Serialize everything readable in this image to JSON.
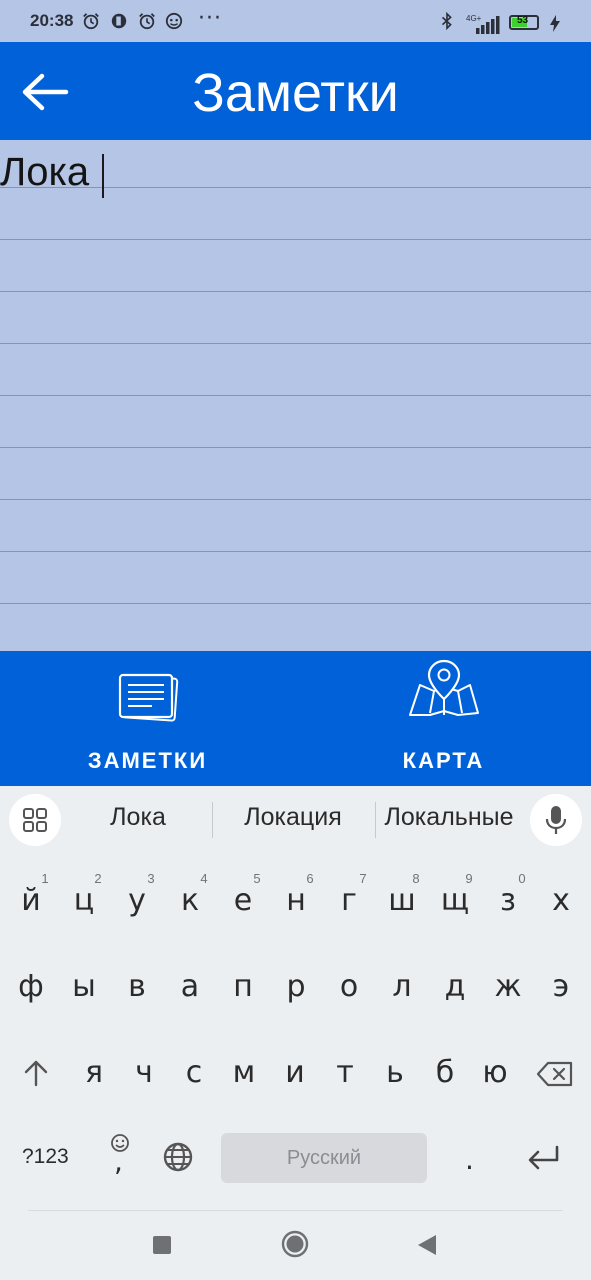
{
  "status_bar": {
    "time": "20:38",
    "left_icons": [
      "alarm-icon",
      "app-notification-icon",
      "alarm-icon",
      "face-icon"
    ],
    "more": "···",
    "right_icons": [
      "bluetooth-icon",
      "network-4g-icon",
      "signal-icon",
      "battery-icon",
      "charging-icon"
    ],
    "network_label": "4G+",
    "battery_percent": "53"
  },
  "app_bar": {
    "title": "Заметки",
    "back_icon": "arrow-left-icon"
  },
  "note": {
    "text": "Лока"
  },
  "bottom_nav": {
    "items": [
      {
        "label": "ЗАМЕТКИ",
        "icon": "notes-icon"
      },
      {
        "label": "КАРТА",
        "icon": "map-icon"
      }
    ]
  },
  "keyboard": {
    "suggestions": [
      "Лока",
      "Локация",
      "Локальные"
    ],
    "row1": [
      {
        "key": "й",
        "hint": "1"
      },
      {
        "key": "ц",
        "hint": "2"
      },
      {
        "key": "у",
        "hint": "3"
      },
      {
        "key": "к",
        "hint": "4"
      },
      {
        "key": "е",
        "hint": "5"
      },
      {
        "key": "н",
        "hint": "6"
      },
      {
        "key": "г",
        "hint": "7"
      },
      {
        "key": "ш",
        "hint": "8"
      },
      {
        "key": "щ",
        "hint": "9"
      },
      {
        "key": "з",
        "hint": "0"
      },
      {
        "key": "х",
        "hint": ""
      }
    ],
    "row2": [
      "ф",
      "ы",
      "в",
      "а",
      "п",
      "р",
      "о",
      "л",
      "д",
      "ж",
      "э"
    ],
    "row3": [
      "я",
      "ч",
      "с",
      "м",
      "и",
      "т",
      "ь",
      "б",
      "ю"
    ],
    "symbols_label": "?123",
    "comma": ",",
    "space_label": "Русский",
    "period": "."
  },
  "colors": {
    "primary": "#0061d8",
    "background": "#b5c5e5",
    "rule_line": "#6f96e2",
    "keyboard_bg": "#eceff2"
  }
}
